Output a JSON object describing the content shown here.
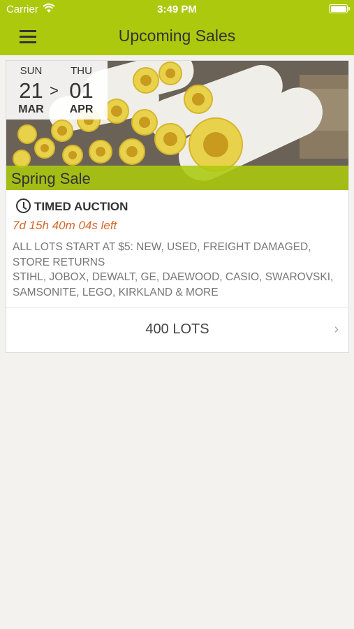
{
  "status_bar": {
    "carrier": "Carrier",
    "time": "3:49 PM"
  },
  "header": {
    "title": "Upcoming Sales",
    "background": "#acc90e"
  },
  "sale": {
    "start": {
      "dow": "SUN",
      "day": "21",
      "month": "MAR"
    },
    "separator": ">",
    "end": {
      "dow": "THU",
      "day": "01",
      "month": "APR"
    },
    "name": "Spring Sale",
    "type": "TIMED AUCTION",
    "countdown": "7d 15h 40m 04s left",
    "description": "ALL LOTS START AT $5: NEW, USED, FREIGHT DAMAGED, STORE RETURNS\nSTIHL, JOBOX, DEWALT, GE, DAEWOOD, CASIO, SWAROVSKI, SAMSONITE, LEGO, KIRKLAND & MORE",
    "lots_label": "400 LOTS",
    "accent": "#d3662b"
  }
}
